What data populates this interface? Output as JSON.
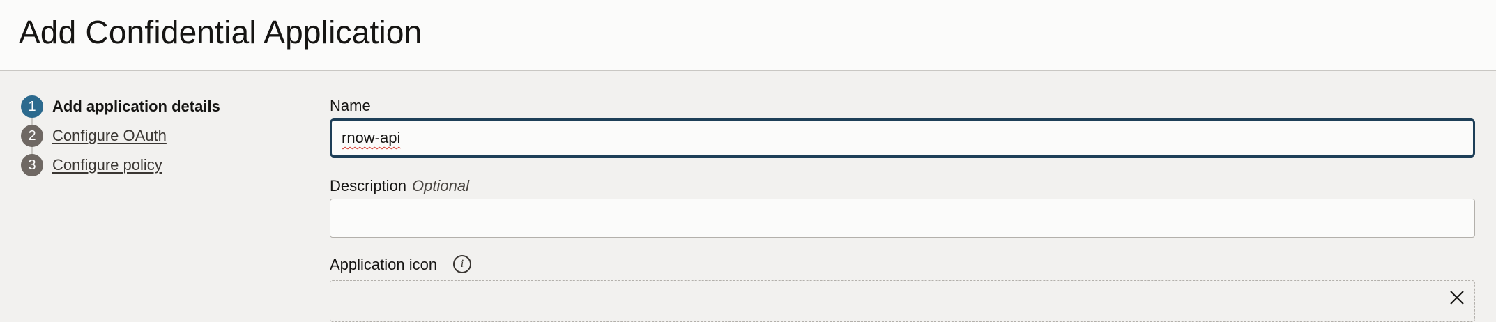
{
  "header": {
    "title": "Add Confidential Application"
  },
  "steps": [
    {
      "number": "1",
      "label": "Add application details",
      "state": "current"
    },
    {
      "number": "2",
      "label": "Configure OAuth",
      "state": "link"
    },
    {
      "number": "3",
      "label": "Configure policy",
      "state": "link"
    }
  ],
  "form": {
    "name": {
      "label": "Name",
      "value": "rnow-api"
    },
    "description": {
      "label": "Description",
      "optional_text": "Optional",
      "value": ""
    },
    "application_icon": {
      "label": "Application icon",
      "info_icon": "info-icon",
      "clear_icon": "close-icon"
    }
  },
  "colors": {
    "active_step": "#2c6a8e",
    "inactive_step": "#6f6863",
    "focus_border": "#1e3f58",
    "header_bg": "#fbfbfa",
    "page_bg": "#f2f1ef"
  }
}
